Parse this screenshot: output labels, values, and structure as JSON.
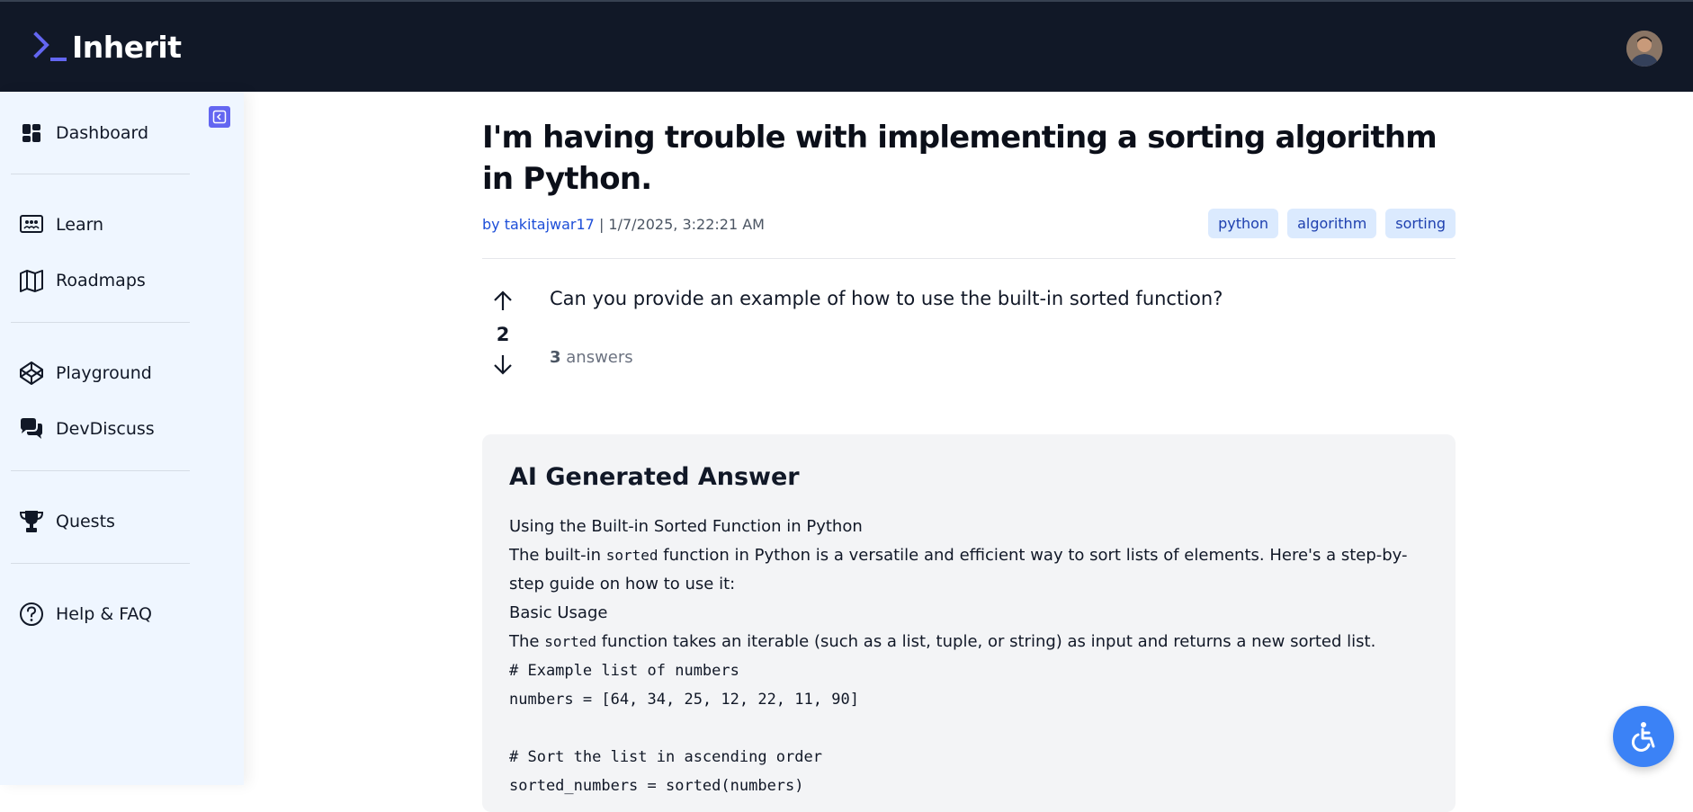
{
  "header": {
    "logo_text": "Inherit",
    "logo_icon": "terminal-prompt-icon",
    "accent": "#6366f1"
  },
  "sidebar": {
    "items": [
      {
        "label": "Dashboard",
        "icon": "dashboard-icon"
      },
      {
        "label": "Learn",
        "icon": "learn-icon"
      },
      {
        "label": "Roadmaps",
        "icon": "map-icon"
      },
      {
        "label": "Playground",
        "icon": "codepen-icon"
      },
      {
        "label": "DevDiscuss",
        "icon": "chat-bubbles-icon"
      },
      {
        "label": "Quests",
        "icon": "trophy-icon"
      },
      {
        "label": "Help & FAQ",
        "icon": "help-circle-icon"
      }
    ]
  },
  "post": {
    "title": "I'm having trouble with implementing a sorting algorithm in Python.",
    "author_prefix": "by takitajwar17",
    "separator": " | ",
    "timestamp": "1/7/2025, 3:22:21 AM",
    "tags": [
      "python",
      "algorithm",
      "sorting"
    ],
    "votes": "2",
    "question": "Can you provide an example of how to use the built-in sorted function?",
    "answer_count": "3",
    "answers_label": " answers"
  },
  "ai_answer": {
    "title": "AI Generated Answer",
    "line1": "Using the Built-in Sorted Function in Python",
    "line2a": "The built-in ",
    "line2_code": "sorted",
    "line2b": " function in Python is a versatile and efficient way to sort lists of elements. Here's a step-by-step guide on how to use it:",
    "line3": "Basic Usage",
    "line4a": "The ",
    "line4_code": "sorted",
    "line4b": " function takes an iterable (such as a list, tuple, or string) as input and returns a new sorted list.",
    "code1": "# Example list of numbers",
    "code2": "numbers = [64, 34, 25, 12, 22, 11, 90]",
    "code3": "# Sort the list in ascending order",
    "code4": "sorted_numbers = sorted(numbers)"
  }
}
